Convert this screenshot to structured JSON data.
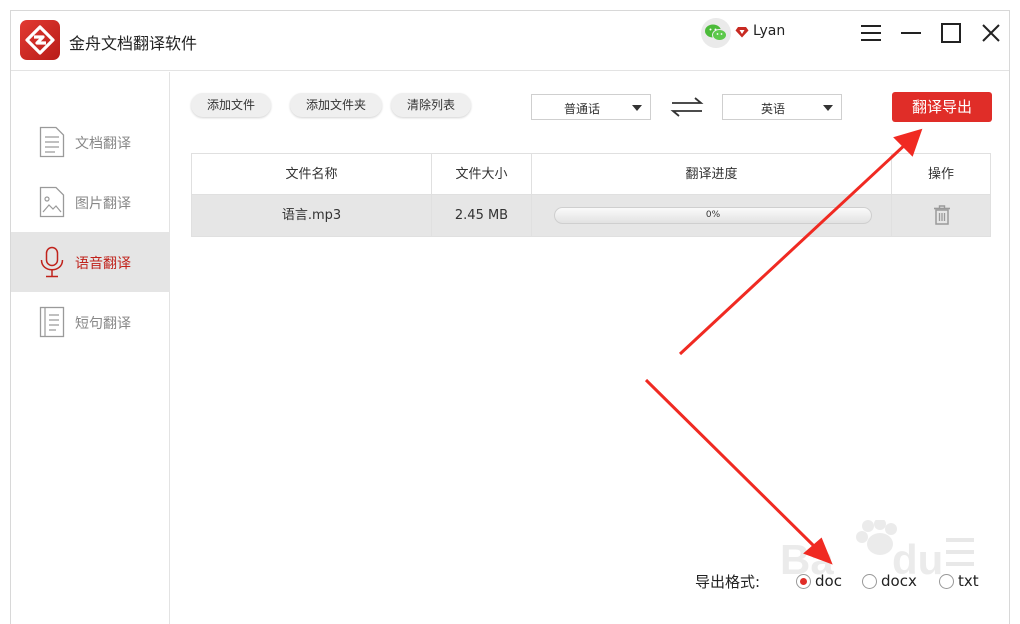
{
  "app": {
    "title": "金舟文档翻译软件",
    "user_name": "Lyan"
  },
  "sidebar": {
    "items": [
      {
        "label": "文档翻译",
        "active": false
      },
      {
        "label": "图片翻译",
        "active": false
      },
      {
        "label": "语音翻译",
        "active": true
      },
      {
        "label": "短句翻译",
        "active": false
      }
    ]
  },
  "toolbar": {
    "add_file": "添加文件",
    "add_folder": "添加文件夹",
    "clear_list": "清除列表",
    "source_lang": "普通话",
    "target_lang": "英语",
    "export": "翻译导出"
  },
  "table": {
    "headers": [
      "文件名称",
      "文件大小",
      "翻译进度",
      "操作"
    ],
    "rows": [
      {
        "name": "语言.mp3",
        "size": "2.45 MB",
        "progress_text": "0%",
        "progress": 0
      }
    ]
  },
  "export_format": {
    "label": "导出格式:",
    "options": [
      "doc",
      "docx",
      "txt"
    ],
    "selected": "doc"
  },
  "watermark": {
    "text": "Baidu经验"
  },
  "colors": {
    "accent": "#e02d28",
    "active_text": "#c0221b",
    "annotation_arrow": "#f02a22"
  }
}
